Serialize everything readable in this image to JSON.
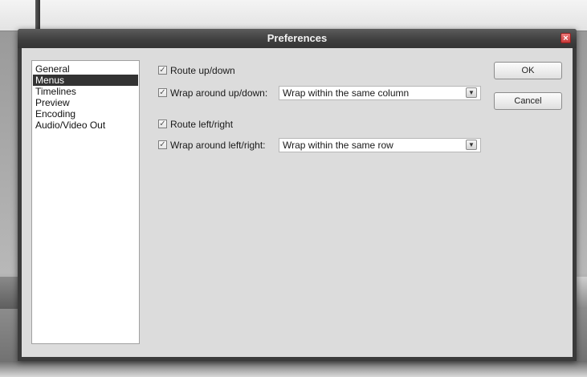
{
  "dialog": {
    "title": "Preferences",
    "close_icon": "close-icon"
  },
  "categories": [
    {
      "label": "General",
      "selected": false
    },
    {
      "label": "Menus",
      "selected": true
    },
    {
      "label": "Timelines",
      "selected": false
    },
    {
      "label": "Preview",
      "selected": false
    },
    {
      "label": "Encoding",
      "selected": false
    },
    {
      "label": "Audio/Video Out",
      "selected": false
    }
  ],
  "options": {
    "route_up_down": {
      "label": "Route up/down",
      "checked": true
    },
    "wrap_up_down": {
      "label": "Wrap around up/down:",
      "checked": true,
      "value": "Wrap within the same column"
    },
    "route_left_right": {
      "label": "Route left/right",
      "checked": true
    },
    "wrap_left_right": {
      "label": "Wrap around left/right:",
      "checked": true,
      "value": "Wrap within the same row"
    }
  },
  "buttons": {
    "ok": "OK",
    "cancel": "Cancel"
  },
  "glyphs": {
    "check": "✓",
    "dropdown": "▼",
    "close": "×"
  },
  "colors": {
    "selection": "#333333",
    "titlebar": "#3e3e3e",
    "close": "#c83a3a"
  }
}
